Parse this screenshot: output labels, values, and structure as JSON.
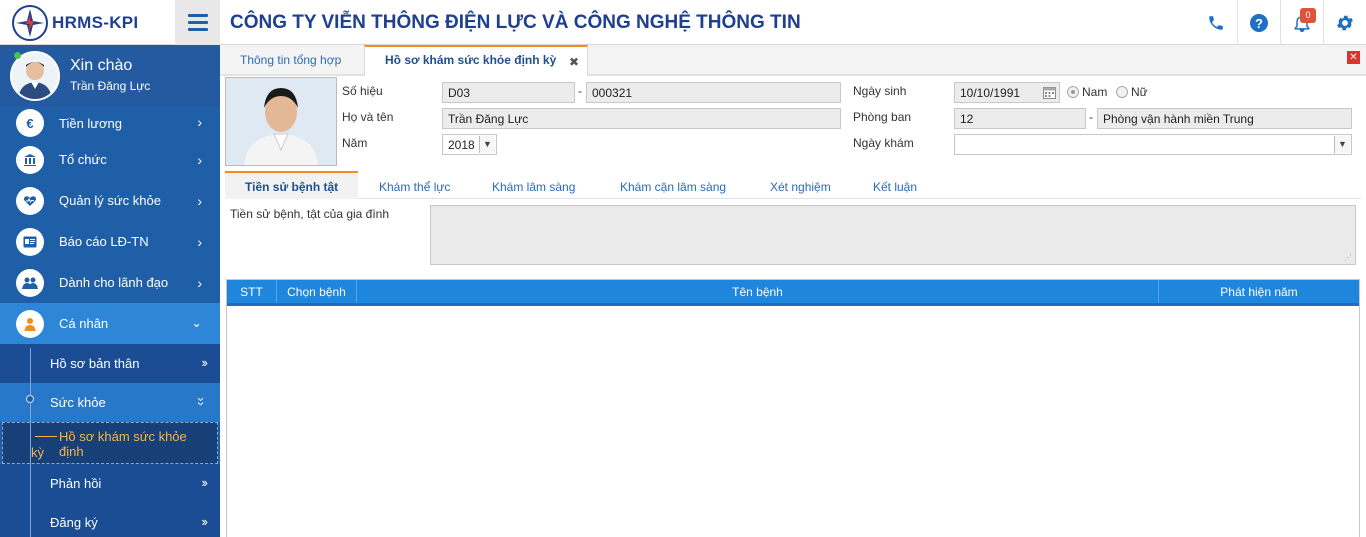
{
  "brand": {
    "logo_text": "HRMS-KPI",
    "company_name": "CÔNG TY VIỄN THÔNG ĐIỆN LỰC VÀ CÔNG NGHỆ THÔNG TIN"
  },
  "header": {
    "notification_count": "0"
  },
  "sidebar": {
    "greeting": "Xin chào",
    "user_name": "Trần Đăng Lực",
    "items": [
      {
        "label": "Tiền lương",
        "icon": "euro-icon"
      },
      {
        "label": "Tổ chức",
        "icon": "bank-icon"
      },
      {
        "label": "Quản lý sức khỏe",
        "icon": "heart-icon"
      },
      {
        "label": "Báo cáo LĐ-TN",
        "icon": "id-card-icon"
      },
      {
        "label": "Dành cho lãnh đạo",
        "icon": "users-icon"
      },
      {
        "label": "Cá nhân",
        "icon": "person-icon"
      }
    ],
    "sub_items": [
      {
        "label": "Hồ sơ bản thân"
      },
      {
        "label": "Sức khỏe"
      },
      {
        "label": "Phản hồi"
      },
      {
        "label": "Đăng ký"
      }
    ],
    "active_leaf": {
      "line1": "Hồ sơ khám sức khỏe định",
      "line2": "kỳ"
    }
  },
  "tabs": {
    "overview": "Thông tin tổng hợp",
    "active": "Hồ sơ khám sức khỏe định kỳ"
  },
  "form": {
    "so_hieu_label": "Số hiệu",
    "so_hieu_prefix": "D03",
    "so_hieu_number": "000321",
    "ho_ten_label": "Họ và tên",
    "ho_ten_value": "Trần Đăng Lực",
    "nam_label": "Năm",
    "nam_value": "2018",
    "ngay_sinh_label": "Ngày sinh",
    "ngay_sinh_value": "10/10/1991",
    "gender_male": "Nam",
    "gender_female": "Nữ",
    "phong_ban_label": "Phòng ban",
    "phong_ban_code": "12",
    "phong_ban_name": "Phòng vận hành miền Trung",
    "ngay_kham_label": "Ngày khám",
    "ngay_kham_value": ""
  },
  "subtabs": [
    "Tiền sử bệnh tật",
    "Khám thể lực",
    "Khám lâm sàng",
    "Khám cận lâm sàng",
    "Xét nghiệm",
    "Kết luận"
  ],
  "history": {
    "family_label": "Tiền sử bệnh, tật của gia đình"
  },
  "table": {
    "columns": [
      "STT",
      "Chọn bệnh",
      "Tên bệnh",
      "Phát hiện năm"
    ]
  },
  "colors": {
    "primary": "#1f5fa8",
    "accent": "#f28c1f",
    "brand": "#1f3f8f"
  }
}
